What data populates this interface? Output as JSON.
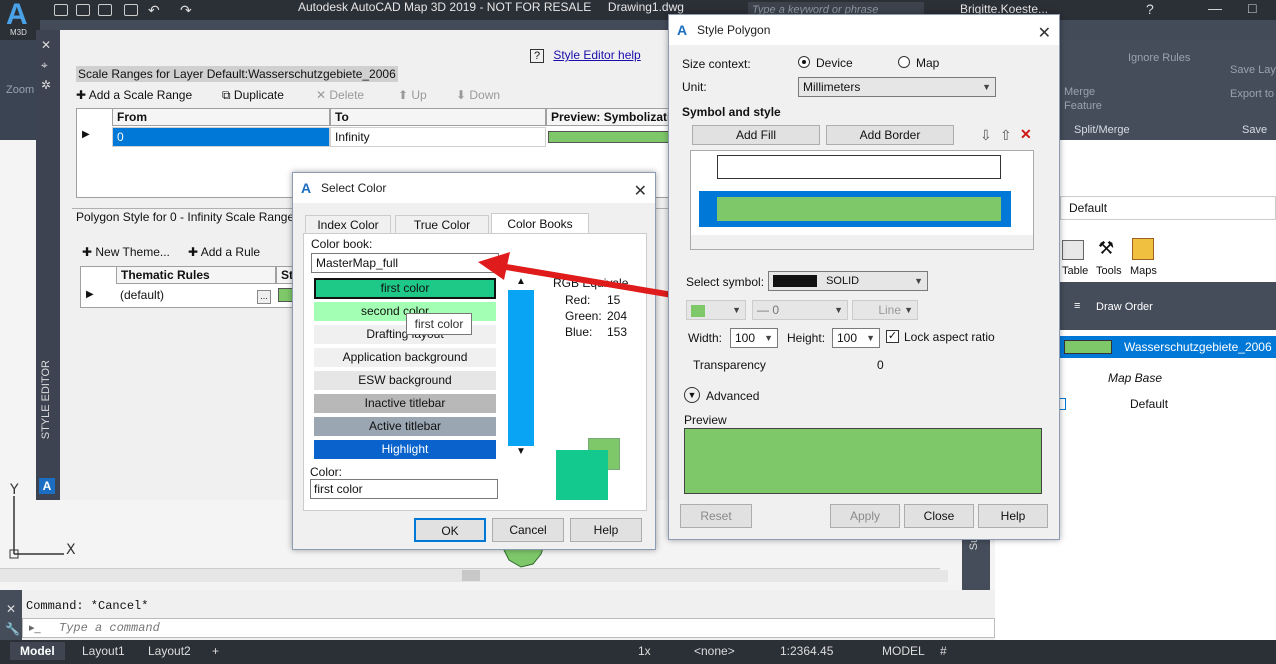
{
  "app": {
    "title": "Autodesk AutoCAD Map 3D 2019 - NOT FOR RESALE     Drawing1.dwg",
    "logo_letter": "A",
    "logo_sub": "M3D",
    "search_placeholder": "Type a keyword or phrase",
    "user": "Brigitte.Koeste..."
  },
  "ribbon": {
    "items": [
      "Ignore Rules",
      "Save Lay",
      "Export to",
      "Merge",
      "Feature"
    ],
    "panel_labels": [
      "Split/Merge",
      "Save"
    ],
    "left_label": "Zoom"
  },
  "style_editor": {
    "side_label": "STYLE EDITOR",
    "help_link": "Style Editor help",
    "scale_header": "Scale Ranges for Layer Default:Wasserschutzgebiete_2006",
    "toolbar": {
      "add_scale_range": "Add a Scale Range",
      "duplicate": "Duplicate",
      "delete": "Delete",
      "up": "Up",
      "down": "Down"
    },
    "grid": {
      "headers": [
        "From",
        "To",
        "Preview: Symbolization"
      ],
      "row": [
        "0",
        "Infinity",
        ""
      ]
    },
    "polygon_style_label": "Polygon Style for 0 - Infinity Scale Range",
    "theme_toolbar": {
      "add_theme": "New Theme...",
      "add_rule": "Add a Rule"
    },
    "rules_grid": {
      "headers": [
        "Thematic Rules",
        "St"
      ],
      "row": [
        "(default)",
        "..."
      ]
    }
  },
  "select_color": {
    "title": "Select Color",
    "tabs": [
      "Index Color",
      "True Color",
      "Color Books"
    ],
    "active_tab": "Color Books",
    "color_book_label": "Color book:",
    "color_book_value": "MasterMap_full",
    "swatches": [
      {
        "label": "first color",
        "bg": "#1ec886",
        "fg": "#111"
      },
      {
        "label": "second color",
        "bg": "#a3ffb3",
        "fg": "#111"
      },
      {
        "label": "Drafting layout",
        "bg": "#f0f0f0",
        "fg": "#111"
      },
      {
        "label": "Application background",
        "bg": "#f0f0f0",
        "fg": "#111"
      },
      {
        "label": "ESW background",
        "bg": "#e6e6e6",
        "fg": "#111"
      },
      {
        "label": "Inactive titlebar",
        "bg": "#b8b8b8",
        "fg": "#111"
      },
      {
        "label": "Active titlebar",
        "bg": "#9aa6b2",
        "fg": "#111"
      },
      {
        "label": "Highlight",
        "bg": "#0a63cc",
        "fg": "#fff"
      }
    ],
    "tooltip": "first color",
    "rgb_title": "RGB Equivalent:",
    "red_label": "Red:",
    "red": "15",
    "green_label": "Green:",
    "green": "204",
    "blue_label": "Blue:",
    "blue": "153",
    "color_label": "Color:",
    "color_value": "first color",
    "ok": "OK",
    "cancel": "Cancel",
    "help": "Help",
    "new_color": "#13c98e",
    "old_color": "#7ec86a"
  },
  "style_polygon": {
    "title": "Style Polygon",
    "size_context_label": "Size context:",
    "device": "Device",
    "map": "Map",
    "unit_label": "Unit:",
    "unit": "Millimeters",
    "symbol_style_label": "Symbol and style",
    "add_fill": "Add Fill",
    "add_border": "Add Border",
    "select_symbol_label": "Select symbol:",
    "symbol": "SOLID",
    "line_weight": "0",
    "line": "Line",
    "width_label": "Width:",
    "width": "100",
    "height_label": "Height:",
    "height": "100",
    "lock_label": "Lock aspect ratio",
    "transparency_label": "Transparency",
    "transparency": "0",
    "advanced": "Advanced",
    "preview_label": "Preview",
    "preview_color": "#7ec86a",
    "reset": "Reset",
    "apply": "Apply",
    "close": "Close",
    "help": "Help"
  },
  "right_panel": {
    "default": "Default",
    "tools": [
      "Table",
      "Tools",
      "Maps"
    ],
    "draw_order": "Draw Order",
    "layer": "Wasserschutzgebiete_2006",
    "map_base": "Map Base",
    "default_item": "Default",
    "survey": "Survey"
  },
  "command": {
    "history": "Command: *Cancel*",
    "placeholder": "Type a command"
  },
  "status": {
    "tabs": [
      "Model",
      "Layout1",
      "Layout2"
    ],
    "scale": "1x",
    "none": "<none>",
    "map_scale": "1:2364.45",
    "model": "MODEL"
  }
}
